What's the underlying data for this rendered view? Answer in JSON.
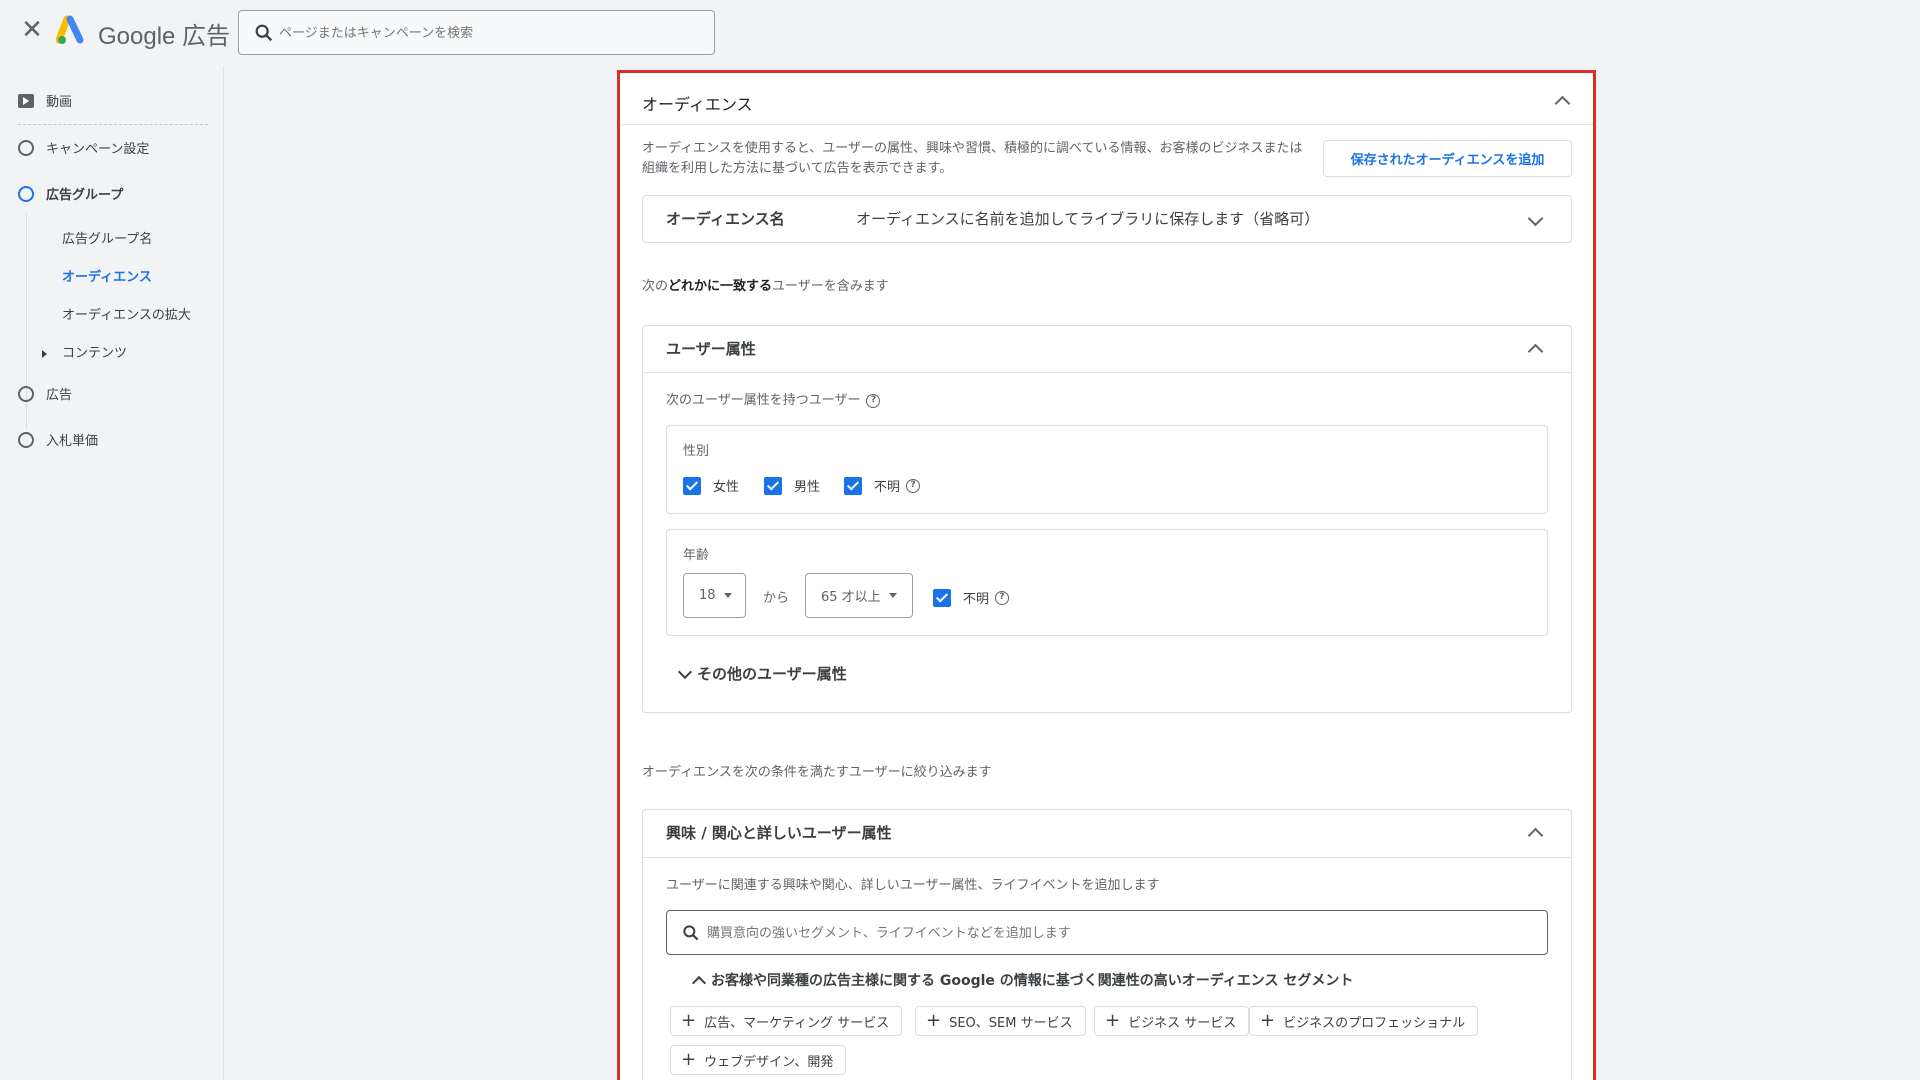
{
  "header": {
    "close_icon": "close-icon",
    "brand_text": "Google 広告",
    "search_placeholder": "ページまたはキャンペーンを検索"
  },
  "sidebar": {
    "video_label": "動画",
    "items": [
      {
        "label": "キャンペーン設定"
      },
      {
        "label": "広告グループ"
      },
      {
        "label": "広告"
      },
      {
        "label": "入札単価"
      }
    ],
    "subitems": [
      {
        "label": "広告グループ名"
      },
      {
        "label": "オーディエンス"
      },
      {
        "label": "オーディエンスの拡大"
      },
      {
        "label": "コンテンツ"
      }
    ]
  },
  "audience": {
    "title": "オーディエンス",
    "description": "オーディエンスを使用すると、ユーザーの属性、興味や習慣、積極的に調べている情報、お客様のビジネスまたは組織を利用した方法に基づいて広告を表示できます。",
    "add_saved_button": "保存されたオーディエンスを追加",
    "name_label": "オーディエンス名",
    "name_hint": "オーディエンスに名前を追加してライブラリに保存します（省略可）",
    "include_prefix": "次の",
    "include_bold": "どれかに一致する",
    "include_suffix": "ユーザーを含みます"
  },
  "demographics": {
    "title": "ユーザー属性",
    "subtitle": "次のユーザー属性を持つユーザー",
    "gender_label": "性別",
    "gender_options": [
      "女性",
      "男性",
      "不明"
    ],
    "age_label": "年齢",
    "age_from": "18",
    "age_between": "から",
    "age_to": "65 才以上",
    "age_unknown": "不明",
    "more_label": "その他のユーザー属性"
  },
  "narrow": {
    "text": "オーディエンスを次の条件を満たすユーザーに絞り込みます"
  },
  "interests": {
    "title": "興味 / 関心と詳しいユーザー属性",
    "subtitle": "ユーザーに関連する興味や関心、詳しいユーザー属性、ライフイベントを追加します",
    "search_placeholder": "購買意向の強いセグメント、ライフイベントなどを追加します",
    "relevant_title": "お客様や同業種の広告主様に関する Google の情報に基づく関連性の高いオーディエンス セグメント",
    "chips": [
      "広告、マーケティング サービス",
      "SEO、SEM サービス",
      "ビジネス サービス",
      "ビジネスのプロフェッショナル",
      "ウェブデザイン、開発"
    ]
  },
  "colors": {
    "accent": "#1a73e8",
    "highlight_border": "#d93025"
  }
}
